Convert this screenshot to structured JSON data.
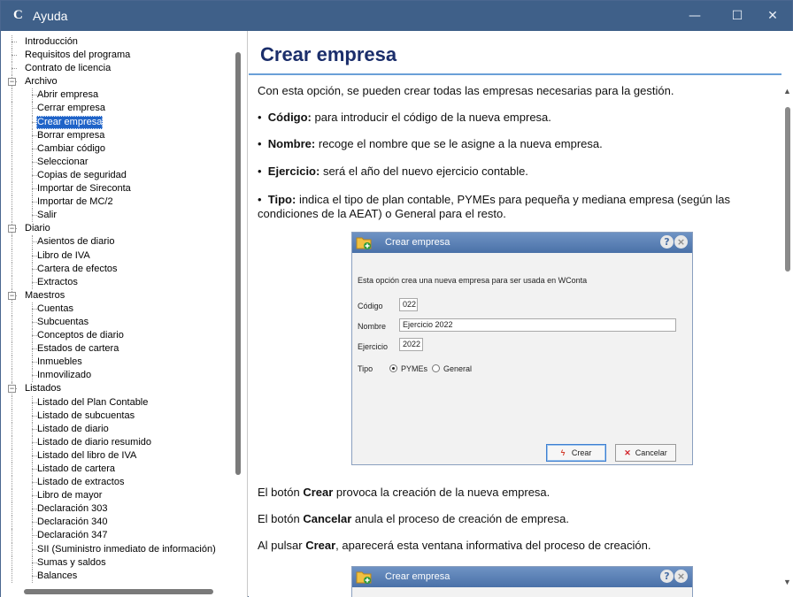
{
  "window": {
    "title": "Ayuda",
    "icon": "app-logo-icon",
    "controls": [
      "minimize-icon",
      "maximize-icon",
      "close-icon"
    ]
  },
  "tree": [
    {
      "label": "Introducción",
      "level": 0
    },
    {
      "label": "Requisitos del programa",
      "level": 0
    },
    {
      "label": "Contrato de licencia",
      "level": 0
    },
    {
      "label": "Archivo",
      "level": 0,
      "expander": "−"
    },
    {
      "label": "Abrir empresa",
      "level": 1
    },
    {
      "label": "Cerrar empresa",
      "level": 1
    },
    {
      "label": "Crear empresa",
      "level": 1,
      "selected": true
    },
    {
      "label": "Borrar empresa",
      "level": 1
    },
    {
      "label": "Cambiar código",
      "level": 1
    },
    {
      "label": "Seleccionar",
      "level": 1
    },
    {
      "label": "Copias de seguridad",
      "level": 1
    },
    {
      "label": "Importar de Sireconta",
      "level": 1
    },
    {
      "label": "Importar de MC/2",
      "level": 1
    },
    {
      "label": "Salir",
      "level": 1
    },
    {
      "label": "Diario",
      "level": 0,
      "expander": "−"
    },
    {
      "label": "Asientos de diario",
      "level": 1
    },
    {
      "label": "Libro de IVA",
      "level": 1
    },
    {
      "label": "Cartera de efectos",
      "level": 1
    },
    {
      "label": "Extractos",
      "level": 1
    },
    {
      "label": "Maestros",
      "level": 0,
      "expander": "−"
    },
    {
      "label": "Cuentas",
      "level": 1
    },
    {
      "label": "Subcuentas",
      "level": 1
    },
    {
      "label": "Conceptos de diario",
      "level": 1
    },
    {
      "label": "Estados de cartera",
      "level": 1
    },
    {
      "label": "Inmuebles",
      "level": 1
    },
    {
      "label": "Inmovilizado",
      "level": 1
    },
    {
      "label": "Listados",
      "level": 0,
      "expander": "−"
    },
    {
      "label": "Listado del Plan Contable",
      "level": 1
    },
    {
      "label": "Listado de subcuentas",
      "level": 1
    },
    {
      "label": "Listado de diario",
      "level": 1
    },
    {
      "label": "Listado de diario resumido",
      "level": 1
    },
    {
      "label": "Listado del libro de IVA",
      "level": 1
    },
    {
      "label": "Listado de cartera",
      "level": 1
    },
    {
      "label": "Listado de extractos",
      "level": 1
    },
    {
      "label": "Libro de mayor",
      "level": 1
    },
    {
      "label": "Declaración 303",
      "level": 1
    },
    {
      "label": "Declaración 340",
      "level": 1
    },
    {
      "label": "Declaración 347",
      "level": 1
    },
    {
      "label": "SII (Suministro inmediato de información)",
      "level": 1
    },
    {
      "label": "Sumas y saldos",
      "level": 1
    },
    {
      "label": "Balances",
      "level": 1
    }
  ],
  "content": {
    "title": "Crear empresa",
    "intro": "Con esta opción, se pueden crear todas las empresas necesarias para la gestión.",
    "bullets": [
      {
        "term": "Código:",
        "text": " para introducir el código de la nueva empresa."
      },
      {
        "term": "Nombre:",
        "text": " recoge el nombre que se le asigne a la nueva empresa."
      },
      {
        "term": "Ejercicio:",
        "text": " será el año del nuevo ejercicio contable."
      },
      {
        "term": "Tipo:",
        "text": " indica el tipo de plan contable, PYMEs para pequeña y mediana empresa (según las condiciones de la AEAT) o General para el resto."
      }
    ],
    "after": [
      {
        "pre": "El botón ",
        "bold": "Crear",
        "post": " provoca la creación de la nueva empresa."
      },
      {
        "pre": "El botón ",
        "bold": "Cancelar",
        "post": " anula el proceso de creación de empresa."
      },
      {
        "pre": "Al pulsar ",
        "bold": "Crear",
        "post": ", aparecerá esta ventana informativa del proceso de creación."
      }
    ],
    "bullet_char": "•"
  },
  "dialog": {
    "title": "Crear empresa",
    "help": "?",
    "close": "×",
    "description": "Esta opción crea una nueva empresa para ser usada en WConta",
    "codigo_label": "Código",
    "codigo_value": "022",
    "nombre_label": "Nombre",
    "nombre_value": "Ejercicio 2022",
    "ejercicio_label": "Ejercicio",
    "ejercicio_value": "2022",
    "tipo_label": "Tipo",
    "tipo_options": [
      "PYMEs",
      "General"
    ],
    "tipo_selected": "PYMEs",
    "crear_label": "Crear",
    "cancelar_label": "Cancelar"
  },
  "dialog2": {
    "title": "Crear empresa",
    "help": "?",
    "close": "×"
  },
  "colors": {
    "titlebar": "#3f6089",
    "selection": "#1f63c8",
    "heading": "#1b2e6b",
    "rule": "#6aa0d8"
  }
}
